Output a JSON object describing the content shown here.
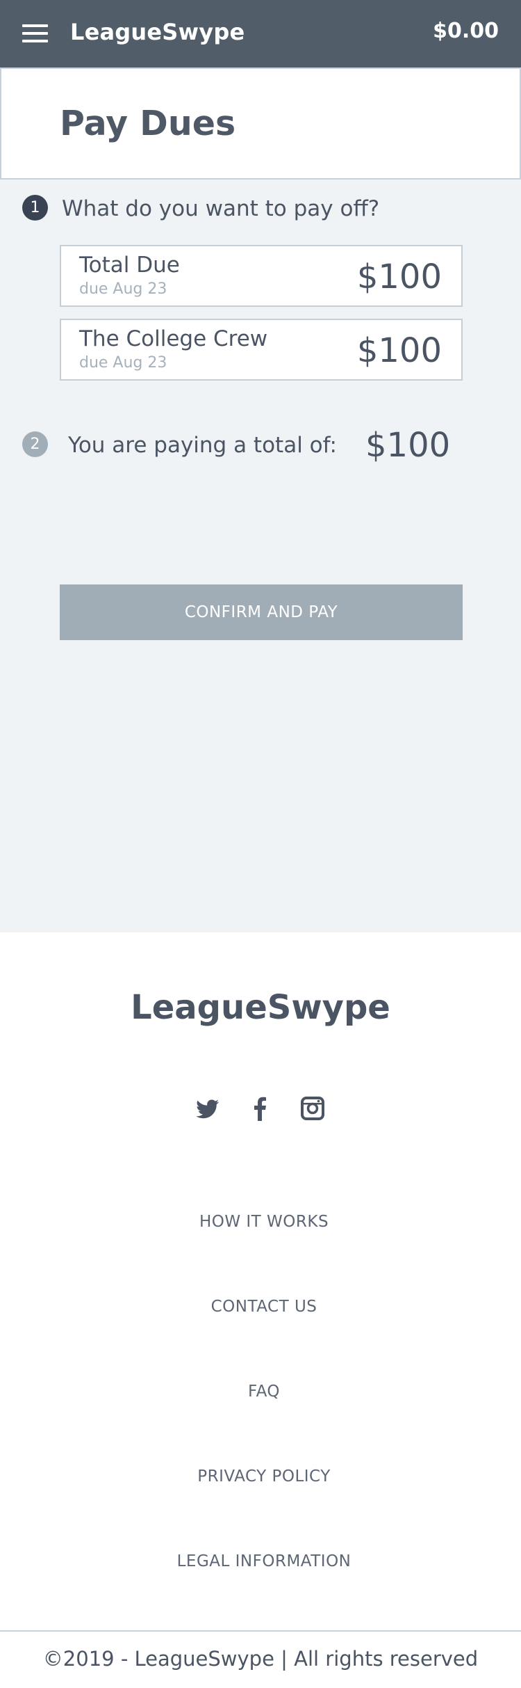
{
  "header": {
    "brand": "LeagueSwype",
    "balance": "$0.00"
  },
  "page_title": "Pay Dues",
  "step1": {
    "number": "1",
    "question": "What do you want to pay off?",
    "items": [
      {
        "name": "Total Due",
        "due": "due Aug 23",
        "amount": "$100"
      },
      {
        "name": "The College Crew",
        "due": "due Aug 23",
        "amount": "$100"
      }
    ]
  },
  "step2": {
    "number": "2",
    "label": "You are paying a total of:",
    "amount": "$100"
  },
  "confirm_label": "CONFIRM AND PAY",
  "footer": {
    "brand": "LeagueSwype",
    "social_icons": [
      "twitter-icon",
      "facebook-icon",
      "instagram-icon"
    ],
    "links": [
      "HOW IT WORKS",
      "CONTACT US",
      "FAQ",
      "PRIVACY POLICY",
      "LEGAL INFORMATION"
    ],
    "copyright": "©2019 - LeagueSwype | All rights reserved"
  },
  "colors": {
    "header_bg": "#525d6a",
    "page_bg": "#eff3f6",
    "text": "#4a5463",
    "button_disabled": "#a1adb6",
    "step_active": "#3a4354",
    "step_inactive": "#a1adb7"
  }
}
